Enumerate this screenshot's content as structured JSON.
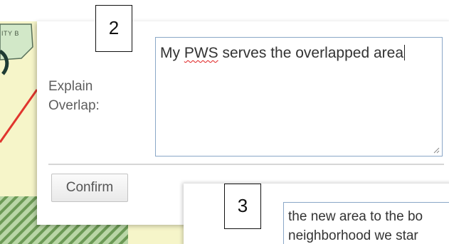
{
  "map": {
    "label": "ITY B",
    "colors": {
      "fill_yellow": "#f6f5c9",
      "fill_green": "#d2e8c8",
      "boundary_red": "#e0352e",
      "hatch_green": "#6c9a56"
    }
  },
  "popup1": {
    "explain_label": "Explain\nOverlap:",
    "explanation_value": {
      "prefix": "My ",
      "misspelled": "PWS",
      "suffix": " serves the overlapped area"
    },
    "confirm_label": "Confirm"
  },
  "popup2": {
    "textarea_lines": [
      "the new area to the bo",
      "neighborhood we star"
    ]
  },
  "callouts": {
    "step_a": "2",
    "step_b": "3"
  }
}
